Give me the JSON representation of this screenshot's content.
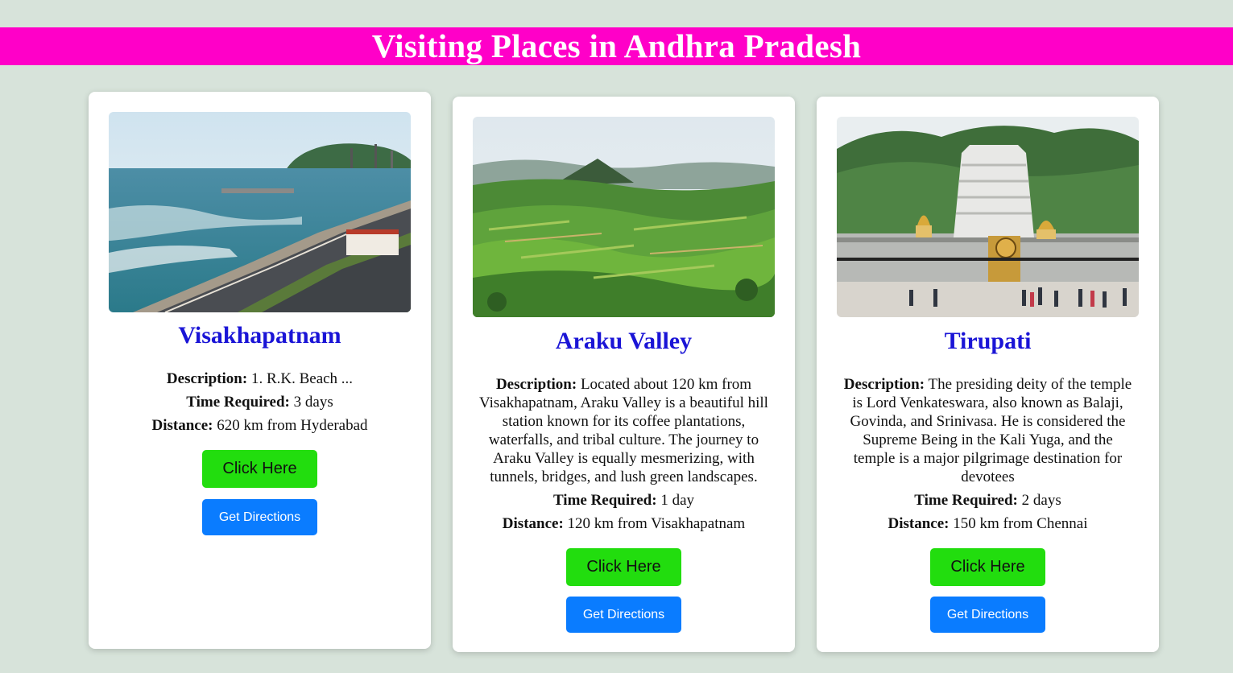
{
  "header": {
    "title": "Visiting Places in Andhra Pradesh"
  },
  "colors": {
    "background": "#d7e3da",
    "banner": "#ff00c8",
    "title_text": "#1a14d6",
    "click_button": "#22dd0e",
    "directions_button": "#0a7cff"
  },
  "labels": {
    "description": "Description:",
    "time_required": "Time Required:",
    "distance": "Distance:"
  },
  "places": [
    {
      "name": "Visakhapatnam",
      "image": "coastal-road-beach-photo",
      "description": " 1. R.K. Beach ...",
      "time_required": " 3 days",
      "distance": " 620 km from Hyderabad",
      "click_label": "Click Here",
      "directions_label": "Get Directions"
    },
    {
      "name": "Araku Valley",
      "image": "green-valley-hills-photo",
      "description": " Located about 120 km from Visakhapatnam, Araku Valley is a beautiful hill station known for its coffee plantations, waterfalls, and tribal culture. The journey to Araku Valley is equally mesmerizing, with tunnels, bridges, and lush green landscapes.",
      "time_required": " 1 day",
      "distance": " 120 km from Visakhapatnam",
      "click_label": "Click Here",
      "directions_label": "Get Directions"
    },
    {
      "name": "Tirupati",
      "image": "temple-gopuram-photo",
      "description": " The presiding deity of the temple is Lord Venkateswara, also known as Balaji, Govinda, and Srinivasa. He is considered the Supreme Being in the Kali Yuga, and the temple is a major pilgrimage destination for devotees",
      "time_required": " 2 days",
      "distance": " 150 km from Chennai",
      "click_label": "Click Here",
      "directions_label": "Get Directions"
    }
  ]
}
